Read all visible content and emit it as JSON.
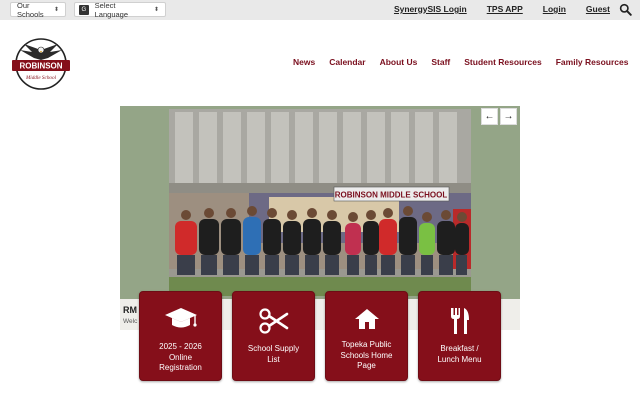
{
  "topbar": {
    "schools_select": "Our Schools",
    "language_select": "Select Language",
    "google_glyph": "G",
    "links": [
      "SynergySIS Login",
      "TPS APP",
      "Login",
      "Guest"
    ],
    "icons": {
      "search": "search-icon"
    }
  },
  "logo": {
    "school_name": "ROBINSON",
    "subtitle": "Middle School"
  },
  "nav": {
    "items": [
      "News",
      "Calendar",
      "About Us",
      "Staff",
      "Student Resources",
      "Family Resources"
    ]
  },
  "slider": {
    "banner_text": "ROBINSON MIDDLE SCHOOL",
    "caption_title": "RM",
    "caption_sub": "Welc",
    "icons": {
      "prev": "arrow-left-icon",
      "next": "arrow-right-icon"
    },
    "prev_glyph": "←",
    "next_glyph": "→"
  },
  "tiles": [
    {
      "label": [
        "2025 - 2026",
        "Online",
        "Registration"
      ],
      "icon": "graduation-cap-icon"
    },
    {
      "label": [
        "School Supply",
        "List"
      ],
      "icon": "scissors-icon"
    },
    {
      "label": [
        "Topeka Public",
        "Schools Home",
        "Page"
      ],
      "icon": "home-icon"
    },
    {
      "label": [
        "Breakfast /",
        "Lunch Menu"
      ],
      "icon": "utensils-icon"
    }
  ],
  "colors": {
    "brand_maroon": "#850f1a",
    "nav_text": "#7a0f1e",
    "topbar_bg": "#e9e9e9",
    "slider_bg": "#94a587"
  }
}
